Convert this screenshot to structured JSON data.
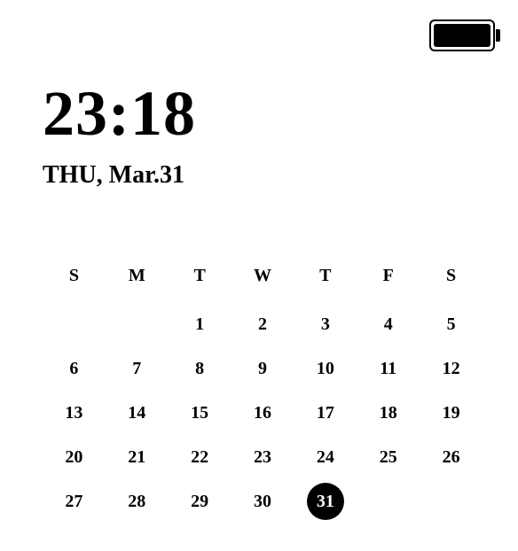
{
  "status": {
    "battery_level": 100
  },
  "clock": {
    "time": "23:18",
    "date": "THU, Mar.31"
  },
  "calendar": {
    "weekdays": [
      "S",
      "M",
      "T",
      "W",
      "T",
      "F",
      "S"
    ],
    "today": 31,
    "weeks": [
      [
        "",
        "",
        "1",
        "2",
        "3",
        "4",
        "5"
      ],
      [
        "6",
        "7",
        "8",
        "9",
        "10",
        "11",
        "12"
      ],
      [
        "13",
        "14",
        "15",
        "16",
        "17",
        "18",
        "19"
      ],
      [
        "20",
        "21",
        "22",
        "23",
        "24",
        "25",
        "26"
      ],
      [
        "27",
        "28",
        "29",
        "30",
        "31",
        "",
        ""
      ]
    ]
  }
}
